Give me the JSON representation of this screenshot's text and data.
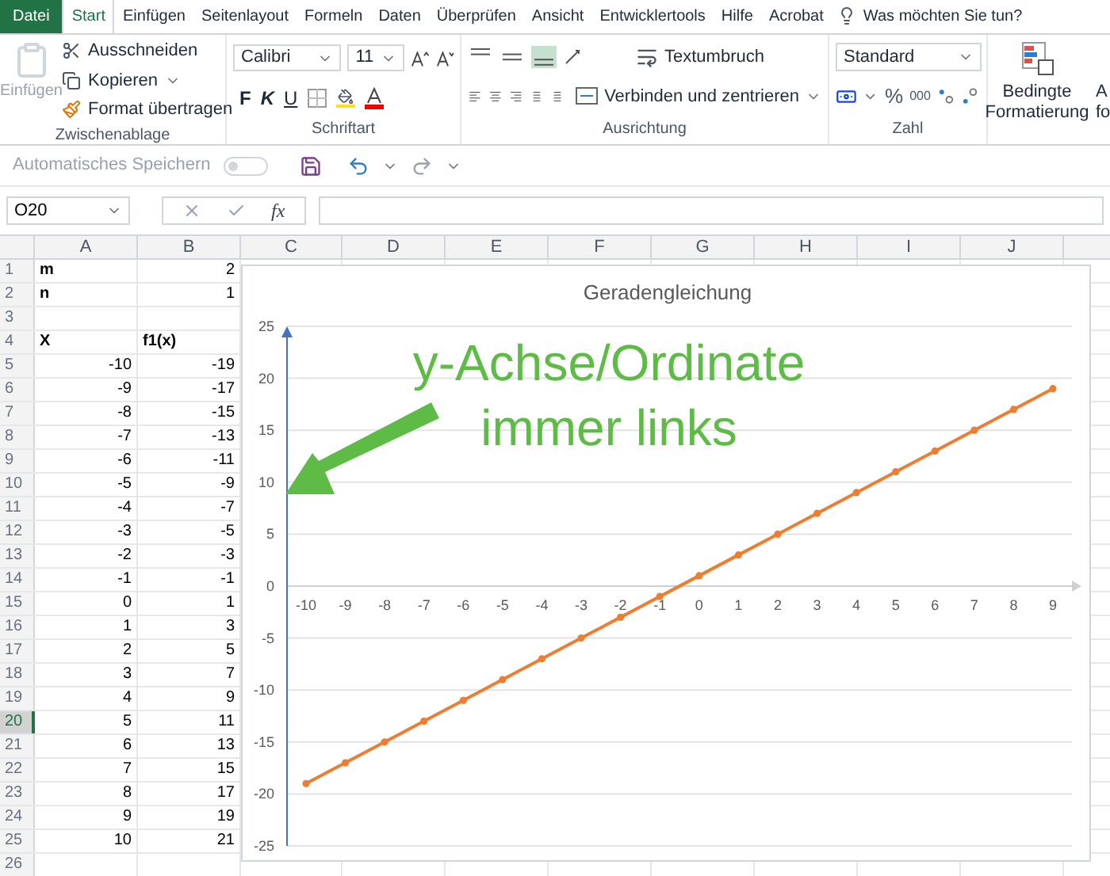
{
  "menu_tabs": [
    {
      "label": "Datei",
      "selected": false,
      "kind": "file"
    },
    {
      "label": "Start",
      "selected": true,
      "kind": "tab"
    },
    {
      "label": "Einfügen",
      "selected": false,
      "kind": "tab"
    },
    {
      "label": "Seitenlayout",
      "selected": false,
      "kind": "tab"
    },
    {
      "label": "Formeln",
      "selected": false,
      "kind": "tab"
    },
    {
      "label": "Daten",
      "selected": false,
      "kind": "tab"
    },
    {
      "label": "Überprüfen",
      "selected": false,
      "kind": "tab"
    },
    {
      "label": "Ansicht",
      "selected": false,
      "kind": "tab"
    },
    {
      "label": "Entwicklertools",
      "selected": false,
      "kind": "tab"
    },
    {
      "label": "Hilfe",
      "selected": false,
      "kind": "tab"
    },
    {
      "label": "Acrobat",
      "selected": false,
      "kind": "tab"
    }
  ],
  "tell_me": "Was möchten Sie tun?",
  "ribbon": {
    "clipboard": {
      "paste": "Einfügen",
      "cut": "Ausschneiden",
      "copy": "Kopieren",
      "format_painter": "Format übertragen",
      "label": "Zwischenablage"
    },
    "font": {
      "name": "Calibri",
      "size": "11",
      "bold": "F",
      "italic": "K",
      "underline": "U",
      "label": "Schriftart"
    },
    "alignment": {
      "wrap": "Textumbruch",
      "merge": "Verbinden und zentrieren",
      "label": "Ausrichtung"
    },
    "number": {
      "format": "Standard",
      "percent": "%",
      "thousands": "000",
      "label": "Zahl"
    },
    "styles": {
      "conditional_top": "Bedingte",
      "conditional_bottom": "Formatierung",
      "cut_top": "A",
      "cut_bottom": "fo"
    }
  },
  "quick_access": {
    "autosave": "Automatisches Speichern",
    "autosave_on": false
  },
  "formula_bar": {
    "name_box": "O20",
    "function_label": "fx"
  },
  "sheet": {
    "columns": [
      "A",
      "B",
      "C",
      "D",
      "E",
      "F",
      "G",
      "H",
      "I",
      "J"
    ],
    "rows": [
      {
        "header": "1",
        "selected": false,
        "cells": [
          {
            "text": "m",
            "kind": "label"
          },
          {
            "text": "2",
            "kind": "number"
          }
        ]
      },
      {
        "header": "2",
        "selected": false,
        "cells": [
          {
            "text": "n",
            "kind": "label"
          },
          {
            "text": "1",
            "kind": "number"
          }
        ]
      },
      {
        "header": "3",
        "selected": false,
        "cells": []
      },
      {
        "header": "4",
        "selected": false,
        "cells": [
          {
            "text": "X",
            "kind": "label"
          },
          {
            "text": "f1(x)",
            "kind": "label"
          }
        ]
      },
      {
        "header": "5",
        "selected": false,
        "cells": [
          {
            "text": "-10",
            "kind": "number"
          },
          {
            "text": "-19",
            "kind": "number"
          }
        ]
      },
      {
        "header": "6",
        "selected": false,
        "cells": [
          {
            "text": "-9",
            "kind": "number"
          },
          {
            "text": "-17",
            "kind": "number"
          }
        ]
      },
      {
        "header": "7",
        "selected": false,
        "cells": [
          {
            "text": "-8",
            "kind": "number"
          },
          {
            "text": "-15",
            "kind": "number"
          }
        ]
      },
      {
        "header": "8",
        "selected": false,
        "cells": [
          {
            "text": "-7",
            "kind": "number"
          },
          {
            "text": "-13",
            "kind": "number"
          }
        ]
      },
      {
        "header": "9",
        "selected": false,
        "cells": [
          {
            "text": "-6",
            "kind": "number"
          },
          {
            "text": "-11",
            "kind": "number"
          }
        ]
      },
      {
        "header": "10",
        "selected": false,
        "cells": [
          {
            "text": "-5",
            "kind": "number"
          },
          {
            "text": "-9",
            "kind": "number"
          }
        ]
      },
      {
        "header": "11",
        "selected": false,
        "cells": [
          {
            "text": "-4",
            "kind": "number"
          },
          {
            "text": "-7",
            "kind": "number"
          }
        ]
      },
      {
        "header": "12",
        "selected": false,
        "cells": [
          {
            "text": "-3",
            "kind": "number"
          },
          {
            "text": "-5",
            "kind": "number"
          }
        ]
      },
      {
        "header": "13",
        "selected": false,
        "cells": [
          {
            "text": "-2",
            "kind": "number"
          },
          {
            "text": "-3",
            "kind": "number"
          }
        ]
      },
      {
        "header": "14",
        "selected": false,
        "cells": [
          {
            "text": "-1",
            "kind": "number"
          },
          {
            "text": "-1",
            "kind": "number"
          }
        ]
      },
      {
        "header": "15",
        "selected": false,
        "cells": [
          {
            "text": "0",
            "kind": "number"
          },
          {
            "text": "1",
            "kind": "number"
          }
        ]
      },
      {
        "header": "16",
        "selected": false,
        "cells": [
          {
            "text": "1",
            "kind": "number"
          },
          {
            "text": "3",
            "kind": "number"
          }
        ]
      },
      {
        "header": "17",
        "selected": false,
        "cells": [
          {
            "text": "2",
            "kind": "number"
          },
          {
            "text": "5",
            "kind": "number"
          }
        ]
      },
      {
        "header": "18",
        "selected": false,
        "cells": [
          {
            "text": "3",
            "kind": "number"
          },
          {
            "text": "7",
            "kind": "number"
          }
        ]
      },
      {
        "header": "19",
        "selected": false,
        "cells": [
          {
            "text": "4",
            "kind": "number"
          },
          {
            "text": "9",
            "kind": "number"
          }
        ]
      },
      {
        "header": "20",
        "selected": true,
        "cells": [
          {
            "text": "5",
            "kind": "number"
          },
          {
            "text": "11",
            "kind": "number"
          }
        ]
      },
      {
        "header": "21",
        "selected": false,
        "cells": [
          {
            "text": "6",
            "kind": "number"
          },
          {
            "text": "13",
            "kind": "number"
          }
        ]
      },
      {
        "header": "22",
        "selected": false,
        "cells": [
          {
            "text": "7",
            "kind": "number"
          },
          {
            "text": "15",
            "kind": "number"
          }
        ]
      },
      {
        "header": "23",
        "selected": false,
        "cells": [
          {
            "text": "8",
            "kind": "number"
          },
          {
            "text": "17",
            "kind": "number"
          }
        ]
      },
      {
        "header": "24",
        "selected": false,
        "cells": [
          {
            "text": "9",
            "kind": "number"
          },
          {
            "text": "19",
            "kind": "number"
          }
        ]
      },
      {
        "header": "25",
        "selected": false,
        "cells": [
          {
            "text": "10",
            "kind": "number"
          },
          {
            "text": "21",
            "kind": "number"
          }
        ]
      },
      {
        "header": "26",
        "selected": false,
        "cells": []
      }
    ]
  },
  "chart": {
    "chart_data": {
      "type": "line",
      "title": "Geradengleichung",
      "categories": [
        "-10",
        "-9",
        "-8",
        "-7",
        "-6",
        "-5",
        "-4",
        "-3",
        "-2",
        "-1",
        "0",
        "1",
        "2",
        "3",
        "4",
        "5",
        "6",
        "7",
        "8",
        "9"
      ],
      "grid": true,
      "series": [
        {
          "color": "#ed7d31",
          "marker": "circle",
          "values": [
            -19,
            -17,
            -15,
            -13,
            -11,
            -9,
            -7,
            -5,
            -3,
            -1,
            1,
            3,
            5,
            7,
            9,
            11,
            13,
            15,
            17,
            19
          ]
        }
      ],
      "ylim": [
        -25,
        25
      ],
      "yticks": [
        -25,
        -20,
        -15,
        -10,
        -5,
        0,
        5,
        10,
        15,
        20,
        25
      ]
    },
    "callout": {
      "lines": [
        "y-Achse/Ordinate",
        "immer links"
      ],
      "color": "#5dbb46"
    }
  }
}
